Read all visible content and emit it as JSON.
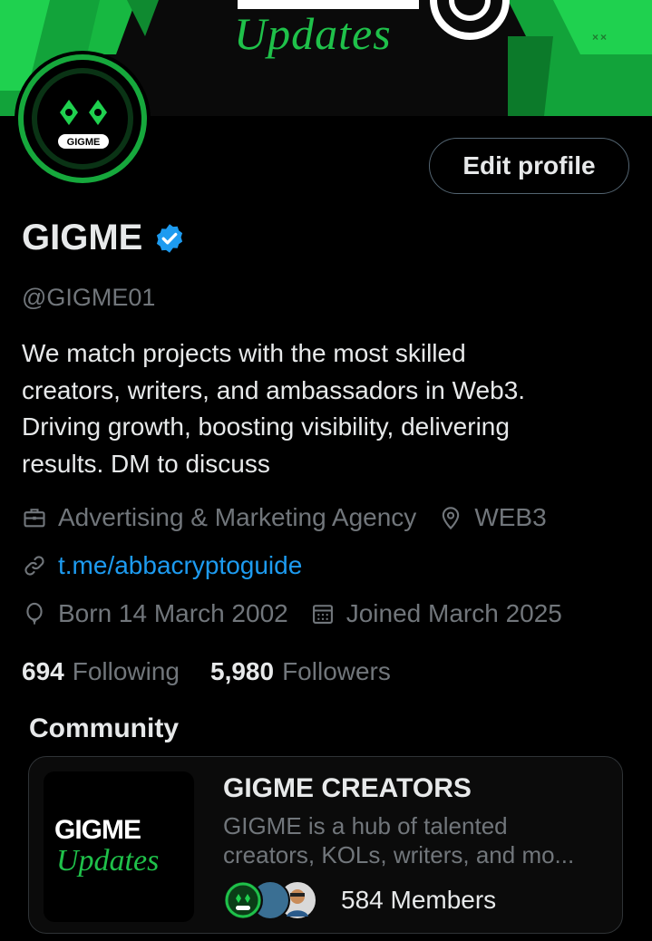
{
  "banner": {
    "title": "Updates",
    "marks": "××"
  },
  "avatar": {
    "label": "GIGME"
  },
  "header": {
    "edit_profile_label": "Edit profile"
  },
  "profile": {
    "name": "GIGME",
    "handle": "@GIGME01",
    "bio_lines": [
      "We match projects with the most skilled",
      "creators, writers, and ambassadors in Web3.",
      "Driving growth, boosting visibility, delivering",
      "results.  DM to discuss"
    ],
    "category": "Advertising & Marketing Agency",
    "location": "WEB3",
    "link": "t.me/abbacryptoguide",
    "born": "Born 14 March 2002",
    "joined": "Joined March 2025",
    "following_count": "694",
    "following_label": "Following",
    "followers_count": "5,980",
    "followers_label": "Followers"
  },
  "community": {
    "section_title": "Community",
    "thumb_line1": "GIGME",
    "thumb_line2": "Updates",
    "name": "GIGME CREATORS",
    "desc_line1": "GIGME is a hub of talented",
    "desc_line2": "creators, KOLs, writers, and mo...",
    "members_text": "584 Members"
  },
  "colors": {
    "accent_link": "#1d9bf0",
    "brand_green": "#1fc14a",
    "muted": "#71767b",
    "text": "#e7e9ea",
    "background": "#000000"
  },
  "icons": [
    "verified-badge-icon",
    "briefcase-icon",
    "location-pin-icon",
    "link-icon",
    "balloon-icon",
    "calendar-icon"
  ]
}
